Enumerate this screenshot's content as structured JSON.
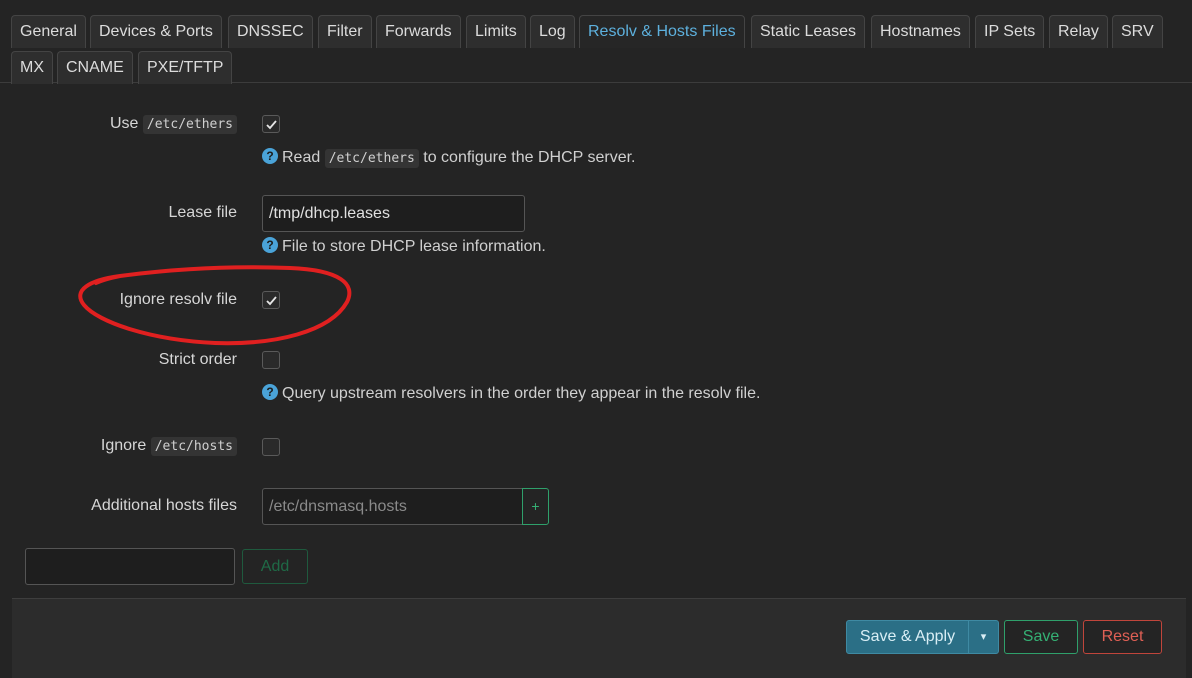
{
  "tabs": [
    {
      "label": "General"
    },
    {
      "label": "Devices & Ports"
    },
    {
      "label": "DNSSEC"
    },
    {
      "label": "Filter"
    },
    {
      "label": "Forwards"
    },
    {
      "label": "Limits"
    },
    {
      "label": "Log"
    },
    {
      "label": "Resolv & Hosts Files",
      "active": true
    },
    {
      "label": "Static Leases"
    },
    {
      "label": "Hostnames"
    },
    {
      "label": "IP Sets"
    },
    {
      "label": "Relay"
    },
    {
      "label": "SRV"
    },
    {
      "label": "MX"
    },
    {
      "label": "CNAME"
    },
    {
      "label": "PXE/TFTP"
    }
  ],
  "form": {
    "use_ethers": {
      "label_prefix": "Use",
      "label_code": "/etc/ethers",
      "checked": true,
      "help_prefix": "Read",
      "help_code": "/etc/ethers",
      "help_suffix": "to configure the DHCP server."
    },
    "lease_file": {
      "label": "Lease file",
      "value": "/tmp/dhcp.leases",
      "help": "File to store DHCP lease information."
    },
    "ignore_resolv": {
      "label": "Ignore resolv file",
      "checked": true
    },
    "strict_order": {
      "label": "Strict order",
      "checked": false,
      "help": "Query upstream resolvers in the order they appear in the resolv file."
    },
    "ignore_hosts": {
      "label_prefix": "Ignore",
      "label_code": "/etc/hosts",
      "checked": false
    },
    "additional_hosts": {
      "label": "Additional hosts files",
      "placeholder": "/etc/dnsmasq.hosts",
      "add_symbol": "+"
    }
  },
  "section_add": {
    "input_value": "",
    "add_label": "Add"
  },
  "footer": {
    "save_apply_label": "Save & Apply",
    "dropdown_symbol": "▾",
    "save_label": "Save",
    "reset_label": "Reset"
  },
  "help_icon_glyph": "?",
  "colors": {
    "accent_blue": "#5db0dd",
    "save_green": "#35b074",
    "reset_red": "#e06055",
    "annotation_red": "#e02020"
  }
}
